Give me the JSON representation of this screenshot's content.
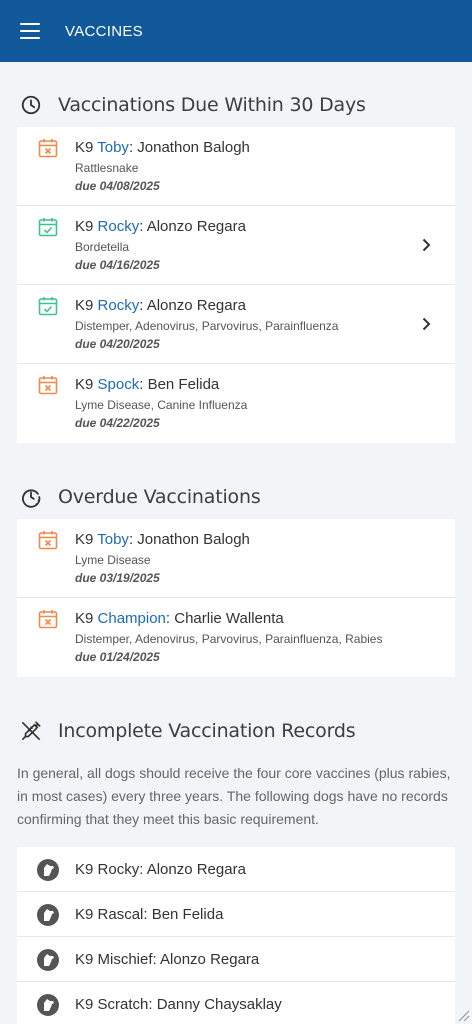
{
  "appbar": {
    "title": "VACCINES",
    "menu_icon": "hamburger-menu-icon"
  },
  "colors": {
    "primary": "#11599b",
    "link": "#1d6bb5",
    "due_soon": "#f08a4b",
    "scheduled": "#3cc48f"
  },
  "due_soon": {
    "heading": "Vaccinations Due Within 30 Days",
    "icon": "clock-icon",
    "items": [
      {
        "prefix": "K9 ",
        "dog": "Toby",
        "sep": ": ",
        "handler": "Jonathon Balogh",
        "vaccines": "Rattlesnake",
        "due": "due 04/08/2025",
        "status": "calendar-x-icon"
      },
      {
        "prefix": "K9 ",
        "dog": "Rocky",
        "sep": ": ",
        "handler": "Alonzo Regara",
        "vaccines": "Bordetella",
        "due": "due 04/16/2025",
        "status": "calendar-check-icon"
      },
      {
        "prefix": "K9 ",
        "dog": "Rocky",
        "sep": ": ",
        "handler": "Alonzo Regara",
        "vaccines": "Distemper, Adenovirus, Parvovirus, Parainfluenza",
        "due": "due 04/20/2025",
        "status": "calendar-check-icon"
      },
      {
        "prefix": "K9 ",
        "dog": "Spock",
        "sep": ": ",
        "handler": "Ben Felida",
        "vaccines": "Lyme Disease, Canine Influenza",
        "due": "due 04/22/2025",
        "status": "calendar-x-icon"
      }
    ]
  },
  "overdue": {
    "heading": "Overdue Vaccinations",
    "icon": "clock-alert-icon",
    "items": [
      {
        "prefix": "K9 ",
        "dog": "Toby",
        "sep": ": ",
        "handler": "Jonathon Balogh",
        "vaccines": "Lyme Disease",
        "due": "due 03/19/2025",
        "status": "calendar-x-icon"
      },
      {
        "prefix": "K9 ",
        "dog": "Champion",
        "sep": ": ",
        "handler": "Charlie Wallenta",
        "vaccines": "Distemper, Adenovirus, Parvovirus, Parainfluenza, Rabies",
        "due": "due 01/24/2025",
        "status": "calendar-x-icon"
      }
    ]
  },
  "incomplete": {
    "heading": "Incomplete Vaccination Records",
    "icon": "syringe-off-icon",
    "description": "In general, all dogs should receive the four core vaccines (plus rabies, in most cases) every three years. The following dogs have no records confirming that they meet this basic requirement.",
    "items": [
      {
        "label": "K9 Rocky: Alonzo Regara"
      },
      {
        "label": "K9 Rascal: Ben Felida"
      },
      {
        "label": "K9 Mischief: Alonzo Regara"
      },
      {
        "label": "K9 Scratch: Danny Chaysaklay"
      }
    ]
  }
}
